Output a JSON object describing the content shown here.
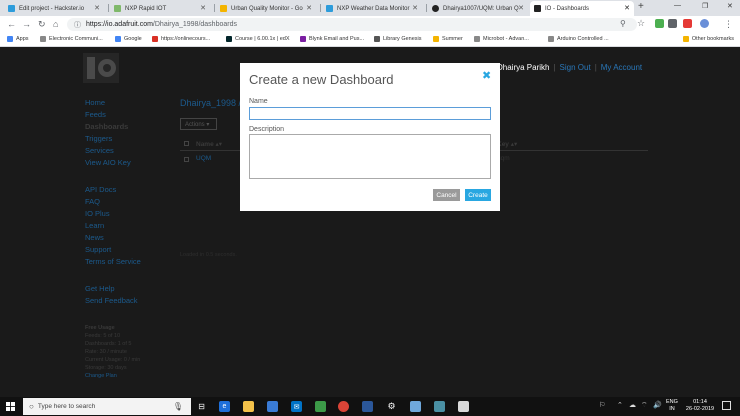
{
  "browser": {
    "tabs": [
      {
        "title": "Edit project - Hackster.io",
        "active": false,
        "favicon_color": "#2d9cdb"
      },
      {
        "title": "NXP Rapid IOT",
        "active": false,
        "favicon_color": "#7fb86a"
      },
      {
        "title": "Urban Quality Monitor - Go",
        "active": false,
        "favicon_color": "#f4b400"
      },
      {
        "title": "NXP Weather Data Monitor",
        "active": false,
        "favicon_color": "#2d9cdb"
      },
      {
        "title": "Dhairya1007/UQM: Urban Q",
        "active": false,
        "favicon_color": "#222222"
      },
      {
        "title": "IO - Dashboards",
        "active": true,
        "favicon_color": "#222222"
      }
    ],
    "url_host": "https://io.adafruit.com",
    "url_path": "/Dhairya_1998/dashboards",
    "bookmarks": [
      {
        "label": "Apps",
        "color": "#4285f4"
      },
      {
        "label": "Electronic Communi...",
        "color": "#888888"
      },
      {
        "label": "Google",
        "color": "#4285f4"
      },
      {
        "label": "https://onlinecours...",
        "color": "#d93025"
      },
      {
        "label": "Course | 6.00.1x | edX",
        "color": "#02262b"
      },
      {
        "label": "Blynk Email and Pus...",
        "color": "#7b1fa2"
      },
      {
        "label": "Library Genesis",
        "color": "#555555"
      },
      {
        "label": "Summer",
        "color": "#f4b400"
      },
      {
        "label": "Microbot - Advan...",
        "color": "#888888"
      },
      {
        "label": "Arduino Controlled ...",
        "color": "#888888"
      }
    ],
    "other_bookmarks": "Other bookmarks"
  },
  "site": {
    "username": "Dhairya Parikh",
    "sign_out": "Sign Out",
    "my_account": "My Account",
    "nav_primary": [
      "Home",
      "Feeds",
      "Dashboards",
      "Triggers",
      "Services",
      "View AIO Key"
    ],
    "nav_active": "Dashboards",
    "nav_secondary": [
      "API Docs",
      "FAQ",
      "IO Plus",
      "Learn",
      "News",
      "Support",
      "Terms of Service"
    ],
    "nav_tertiary": [
      "Get Help",
      "Send Feedback"
    ],
    "usage": {
      "title": "Free Usage",
      "feeds": "Feeds: 5 of 10",
      "dashboards": "Dashboards: 1 of 5",
      "rate": "Rate: 30 / minute",
      "current": "Current Usage: 0 / min",
      "storage": "Storage: 30 days",
      "change_plan": "Change Plan"
    }
  },
  "dashboard_list": {
    "breadcrumb": "Dhairya_1998 /",
    "actions_label": "Actions ▾",
    "columns": {
      "name": "Name ▴▾",
      "key": "Key ▴▾"
    },
    "rows": [
      {
        "name": "UQM",
        "key": "uqm"
      }
    ],
    "loaded_text": "Loaded in 0.5 seconds."
  },
  "modal": {
    "title": "Create a new Dashboard",
    "close": "✖",
    "name_label": "Name",
    "name_value": "",
    "description_label": "Description",
    "description_value": "",
    "cancel_label": "Cancel",
    "create_label": "Create"
  },
  "taskbar": {
    "search_placeholder": "Type here to search",
    "language": "ENG",
    "region": "IN",
    "time": "01:14",
    "date": "26-02-2019"
  },
  "colors": {
    "accent": "#29a7e1",
    "link": "#1c5a8c",
    "overlay": "#1a1a1a"
  }
}
